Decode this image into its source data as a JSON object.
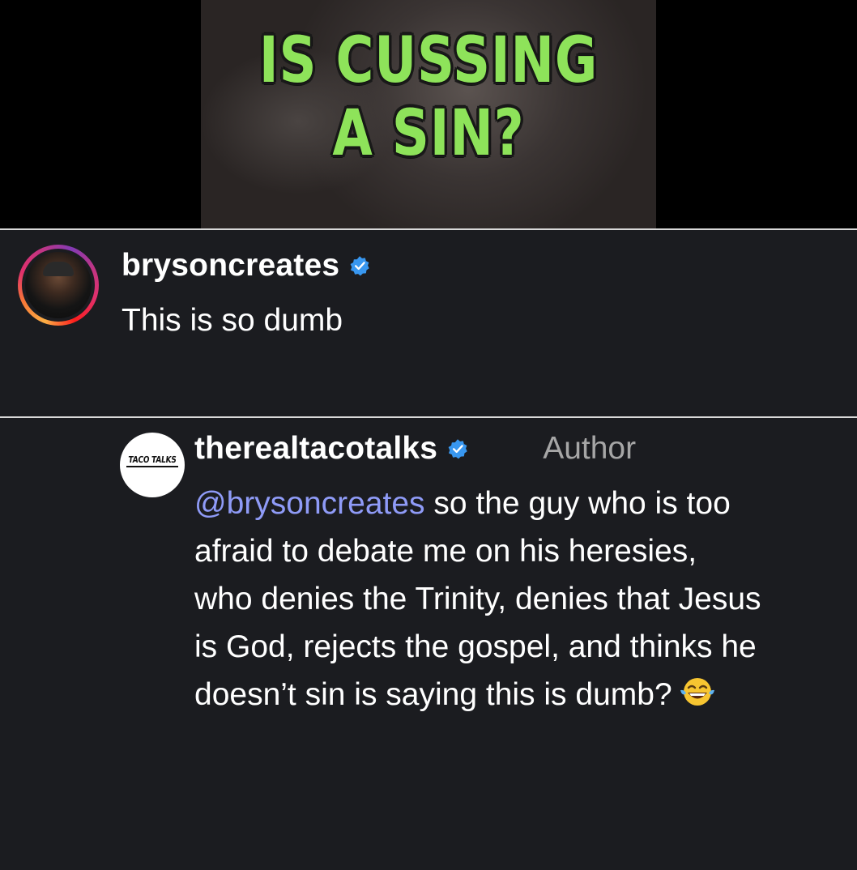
{
  "video": {
    "title_line1": "IS CUSSING",
    "title_line2": "A SIN?",
    "title_color": "#8ee35a"
  },
  "comments": [
    {
      "username": "brysoncreates",
      "verified": true,
      "avatar": "profile-photo-with-story-ring",
      "text": "This is so dumb"
    },
    {
      "username": "therealtacotalks",
      "verified": true,
      "badge": "Author",
      "avatar_logo_text": "TACO TALKS",
      "mention": "@brysoncreates",
      "text": " so the guy who is too afraid to debate me on his heresies, who denies the Trinity, denies that Jesus is God, rejects the gospel, and thinks he doesn’t sin is saying this is dumb?",
      "emoji": "face-with-tears-of-joy-icon"
    }
  ],
  "colors": {
    "background": "#1b1c20",
    "verified_badge": "#3897f0",
    "mention": "#8f9bf7",
    "author_tag": "#a6a6a6"
  }
}
